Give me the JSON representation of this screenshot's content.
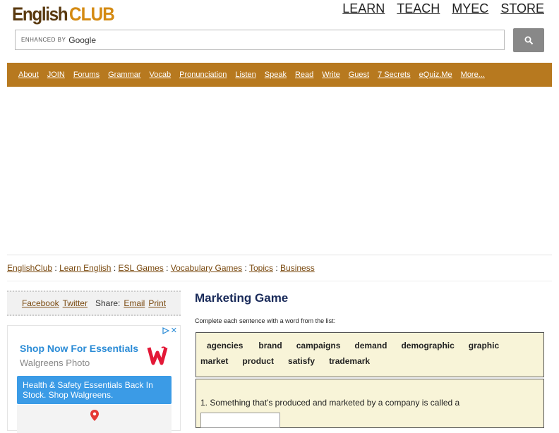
{
  "brand": {
    "part1": "English",
    "part2": "CLUB"
  },
  "topnav": [
    "LEARN",
    "TEACH",
    "MYEC",
    "STORE"
  ],
  "search": {
    "enhanced": "ENHANCED BY",
    "google": "Google"
  },
  "navbar": [
    "About",
    "JOIN",
    "Forums",
    "Grammar",
    "Vocab",
    "Pronunciation",
    "Listen",
    "Speak",
    "Read",
    "Write",
    "Guest",
    "7 Secrets",
    "eQuiz.Me",
    "More..."
  ],
  "breadcrumbs": [
    "EnglishClub",
    "Learn English",
    "ESL Games",
    "Vocabulary Games",
    "Topics",
    "Business"
  ],
  "breadcrumb_sep": ":",
  "share": {
    "facebook": "Facebook",
    "twitter": "Twitter",
    "share_label": "Share:",
    "email": "Email",
    "print": "Print"
  },
  "ad": {
    "title": "Shop Now For Essentials",
    "advertiser": "Walgreens Photo",
    "body": "Health & Safety Essentials Back In Stock. Shop Walgreens.",
    "close": "✕",
    "colors": {
      "accent": "#2a8bd6",
      "logo": "#e31837"
    }
  },
  "game": {
    "title": "Marketing Game",
    "instruction": "Complete each sentence with a word from the list:",
    "words_row1": [
      "agencies",
      "brand",
      "campaigns",
      "demand",
      "demographic",
      "graphic"
    ],
    "words_row2": [
      "market",
      "product",
      "satisfy",
      "trademark"
    ],
    "question1": "1. Something that's produced and marketed by a company is called a"
  },
  "colors": {
    "navbar": "#b7791f",
    "link": "#7a4a10",
    "wordbox": "#f8f4d8",
    "title": "#1a2b5a"
  }
}
